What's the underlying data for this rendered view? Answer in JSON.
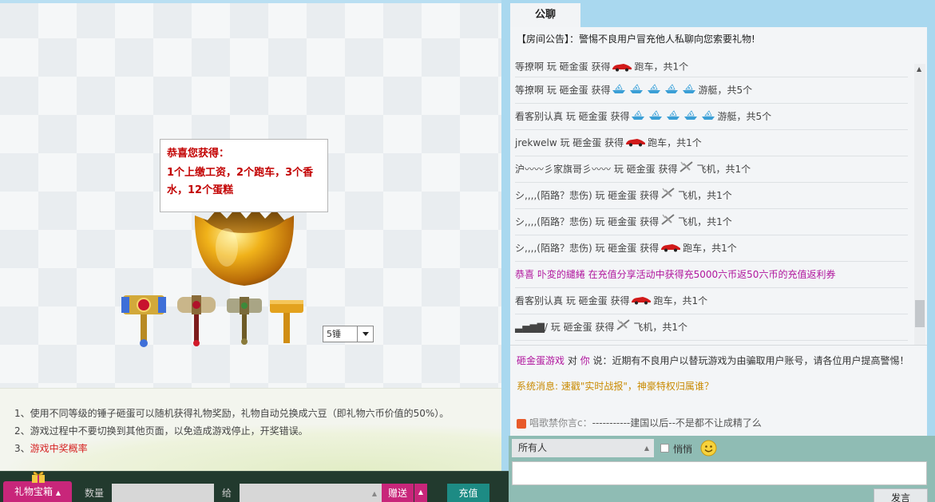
{
  "prize": {
    "title": "恭喜您获得：",
    "text": "1个上缴工资，2个跑车，3个香水，12个蛋糕"
  },
  "hammer_select": {
    "value": "5锤"
  },
  "rules": [
    "1、使用不同等级的锤子砸蛋可以随机获得礼物奖励，礼物自动兑换成六豆（即礼物六币价值的50%）。",
    "2、游戏过程中不要切换到其他页面，以免造成游戏停止，开奖错误。",
    "3、"
  ],
  "rules_link": "游戏中奖概率",
  "bottom": {
    "giftbox": "礼物宝箱",
    "qty_label": "数量",
    "to_label": "给",
    "send": "赠送",
    "recharge": "充值"
  },
  "chat": {
    "tab": "公聊",
    "announcement": "【房间公告】：警惕不良用户冒充他人私聊向您索要礼物!",
    "messages": [
      {
        "text": "等撩啊 玩 砸金蛋 获得",
        "icon": "sports-car-icon",
        "count": 1,
        "item": "跑车，共1个",
        "first": true
      },
      {
        "text": "等撩啊 玩 砸金蛋 获得",
        "icon": "yacht-icon",
        "count": 5,
        "item": "游艇，共5个"
      },
      {
        "text": "看客别认真 玩 砸金蛋 获得",
        "icon": "yacht-icon",
        "count": 5,
        "item": "游艇，共5个"
      },
      {
        "text": "jrekwelw 玩 砸金蛋 获得",
        "icon": "sports-car-icon",
        "count": 1,
        "item": "跑车，共1个"
      },
      {
        "text": "沪〰〰彡家旗哥彡〰〰 玩 砸金蛋 获得",
        "icon": "plane-icon",
        "count": 1,
        "item": "飞机，共1个"
      },
      {
        "text": "シ,,,,(陌路？悲伤) 玩 砸金蛋 获得",
        "icon": "plane-icon",
        "count": 1,
        "item": "飞机，共1个"
      },
      {
        "text": "シ,,,,(陌路？悲伤) 玩 砸金蛋 获得",
        "icon": "plane-icon",
        "count": 1,
        "item": "飞机，共1个"
      },
      {
        "text": "シ,,,,(陌路？悲伤) 玩 砸金蛋 获得",
        "icon": "sports-car-icon",
        "count": 1,
        "item": "跑车，共1个"
      },
      {
        "text": "恭喜 卟変的繾綣 在充值分享活动中获得充5000六币返50六币的充值返利券",
        "congrats": true
      },
      {
        "text": "看客别认真 玩 砸金蛋 获得",
        "icon": "sports-car-icon",
        "count": 1,
        "item": "跑车，共1个"
      },
      {
        "text": "▃▅▆▇/ 玩 砸金蛋 获得",
        "icon": "plane-icon",
        "count": 1,
        "item": "飞机，共1个"
      }
    ],
    "notice_game": {
      "source": "砸金蛋游戏",
      "mid": " 对 ",
      "you": "你",
      "text": " 说：近期有不良用户以替玩游戏为由骗取用户账号，请各位用户提高警惕！"
    },
    "notice_system": "系统消息: 速戳\"实时战报\"，神豪特权归属谁？",
    "notice_shout": {
      "name": "唱歌禁你言c：",
      "text": "-----------建国以后--不是都不让成精了么"
    },
    "target": "所有人",
    "whisper": "悄悄",
    "send": "发言"
  },
  "colors": {
    "accent": "#c8267a",
    "recharge": "#1d8b84",
    "prize_text": "#c20000"
  }
}
